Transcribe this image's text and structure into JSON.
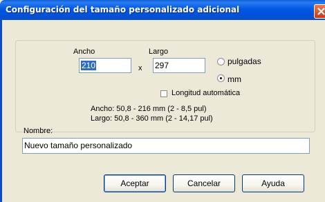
{
  "window": {
    "title": "Configuración del tamaño personalizado adicional"
  },
  "size": {
    "width_label": "Ancho",
    "width_value": "210",
    "times": "x",
    "length_label": "Largo",
    "length_value": "297"
  },
  "units": {
    "inches_label": "pulgadas",
    "mm_label": "mm",
    "selected": "mm"
  },
  "auto_length": {
    "label": "Longitud automática",
    "checked": false
  },
  "ranges": {
    "width": "Ancho: 50,8 - 216 mm  (2 - 8,5 pul)",
    "length": "Largo: 50,8 - 360 mm  (2 - 14,17 pul)"
  },
  "name": {
    "label": "Nombre:",
    "value": "Nuevo tamaño personalizado"
  },
  "buttons": {
    "ok": "Aceptar",
    "cancel": "Cancelar",
    "help": "Ayuda"
  }
}
